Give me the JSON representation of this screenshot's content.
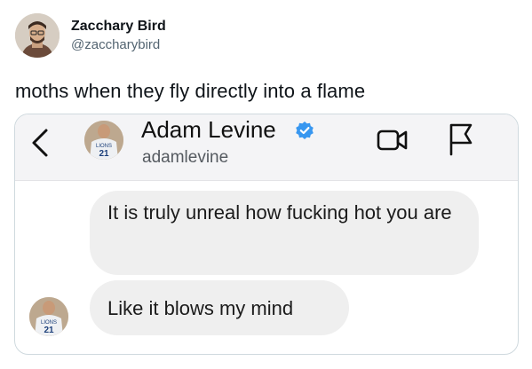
{
  "tweet": {
    "author_name": "Zacchary Bird",
    "author_handle": "@zaccharybird",
    "text": "moths when they fly directly into a flame"
  },
  "dm": {
    "contact_name": "Adam Levine",
    "contact_handle": "adamlevine",
    "jersey_number": "21",
    "messages": [
      {
        "text": "It is truly unreal how fucking hot you are"
      },
      {
        "text": "Like it blows my mind"
      }
    ]
  },
  "icons": {
    "back": "chevron-left-icon",
    "verified": "verified-badge-icon",
    "video": "video-camera-icon",
    "report": "flag-icon"
  },
  "colors": {
    "verified_blue": "#3897f0",
    "bubble_gray": "#efefef",
    "handle_gray": "#536471",
    "card_border": "#cfd9de"
  }
}
